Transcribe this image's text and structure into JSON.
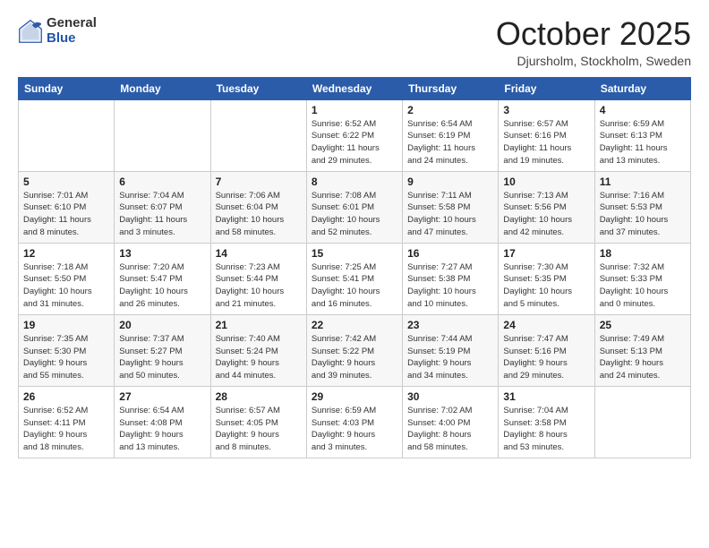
{
  "logo": {
    "general": "General",
    "blue": "Blue"
  },
  "title": {
    "month": "October 2025",
    "location": "Djursholm, Stockholm, Sweden"
  },
  "weekdays": [
    "Sunday",
    "Monday",
    "Tuesday",
    "Wednesday",
    "Thursday",
    "Friday",
    "Saturday"
  ],
  "weeks": [
    [
      {
        "day": "",
        "info": ""
      },
      {
        "day": "",
        "info": ""
      },
      {
        "day": "",
        "info": ""
      },
      {
        "day": "1",
        "info": "Sunrise: 6:52 AM\nSunset: 6:22 PM\nDaylight: 11 hours\nand 29 minutes."
      },
      {
        "day": "2",
        "info": "Sunrise: 6:54 AM\nSunset: 6:19 PM\nDaylight: 11 hours\nand 24 minutes."
      },
      {
        "day": "3",
        "info": "Sunrise: 6:57 AM\nSunset: 6:16 PM\nDaylight: 11 hours\nand 19 minutes."
      },
      {
        "day": "4",
        "info": "Sunrise: 6:59 AM\nSunset: 6:13 PM\nDaylight: 11 hours\nand 13 minutes."
      }
    ],
    [
      {
        "day": "5",
        "info": "Sunrise: 7:01 AM\nSunset: 6:10 PM\nDaylight: 11 hours\nand 8 minutes."
      },
      {
        "day": "6",
        "info": "Sunrise: 7:04 AM\nSunset: 6:07 PM\nDaylight: 11 hours\nand 3 minutes."
      },
      {
        "day": "7",
        "info": "Sunrise: 7:06 AM\nSunset: 6:04 PM\nDaylight: 10 hours\nand 58 minutes."
      },
      {
        "day": "8",
        "info": "Sunrise: 7:08 AM\nSunset: 6:01 PM\nDaylight: 10 hours\nand 52 minutes."
      },
      {
        "day": "9",
        "info": "Sunrise: 7:11 AM\nSunset: 5:58 PM\nDaylight: 10 hours\nand 47 minutes."
      },
      {
        "day": "10",
        "info": "Sunrise: 7:13 AM\nSunset: 5:56 PM\nDaylight: 10 hours\nand 42 minutes."
      },
      {
        "day": "11",
        "info": "Sunrise: 7:16 AM\nSunset: 5:53 PM\nDaylight: 10 hours\nand 37 minutes."
      }
    ],
    [
      {
        "day": "12",
        "info": "Sunrise: 7:18 AM\nSunset: 5:50 PM\nDaylight: 10 hours\nand 31 minutes."
      },
      {
        "day": "13",
        "info": "Sunrise: 7:20 AM\nSunset: 5:47 PM\nDaylight: 10 hours\nand 26 minutes."
      },
      {
        "day": "14",
        "info": "Sunrise: 7:23 AM\nSunset: 5:44 PM\nDaylight: 10 hours\nand 21 minutes."
      },
      {
        "day": "15",
        "info": "Sunrise: 7:25 AM\nSunset: 5:41 PM\nDaylight: 10 hours\nand 16 minutes."
      },
      {
        "day": "16",
        "info": "Sunrise: 7:27 AM\nSunset: 5:38 PM\nDaylight: 10 hours\nand 10 minutes."
      },
      {
        "day": "17",
        "info": "Sunrise: 7:30 AM\nSunset: 5:35 PM\nDaylight: 10 hours\nand 5 minutes."
      },
      {
        "day": "18",
        "info": "Sunrise: 7:32 AM\nSunset: 5:33 PM\nDaylight: 10 hours\nand 0 minutes."
      }
    ],
    [
      {
        "day": "19",
        "info": "Sunrise: 7:35 AM\nSunset: 5:30 PM\nDaylight: 9 hours\nand 55 minutes."
      },
      {
        "day": "20",
        "info": "Sunrise: 7:37 AM\nSunset: 5:27 PM\nDaylight: 9 hours\nand 50 minutes."
      },
      {
        "day": "21",
        "info": "Sunrise: 7:40 AM\nSunset: 5:24 PM\nDaylight: 9 hours\nand 44 minutes."
      },
      {
        "day": "22",
        "info": "Sunrise: 7:42 AM\nSunset: 5:22 PM\nDaylight: 9 hours\nand 39 minutes."
      },
      {
        "day": "23",
        "info": "Sunrise: 7:44 AM\nSunset: 5:19 PM\nDaylight: 9 hours\nand 34 minutes."
      },
      {
        "day": "24",
        "info": "Sunrise: 7:47 AM\nSunset: 5:16 PM\nDaylight: 9 hours\nand 29 minutes."
      },
      {
        "day": "25",
        "info": "Sunrise: 7:49 AM\nSunset: 5:13 PM\nDaylight: 9 hours\nand 24 minutes."
      }
    ],
    [
      {
        "day": "26",
        "info": "Sunrise: 6:52 AM\nSunset: 4:11 PM\nDaylight: 9 hours\nand 18 minutes."
      },
      {
        "day": "27",
        "info": "Sunrise: 6:54 AM\nSunset: 4:08 PM\nDaylight: 9 hours\nand 13 minutes."
      },
      {
        "day": "28",
        "info": "Sunrise: 6:57 AM\nSunset: 4:05 PM\nDaylight: 9 hours\nand 8 minutes."
      },
      {
        "day": "29",
        "info": "Sunrise: 6:59 AM\nSunset: 4:03 PM\nDaylight: 9 hours\nand 3 minutes."
      },
      {
        "day": "30",
        "info": "Sunrise: 7:02 AM\nSunset: 4:00 PM\nDaylight: 8 hours\nand 58 minutes."
      },
      {
        "day": "31",
        "info": "Sunrise: 7:04 AM\nSunset: 3:58 PM\nDaylight: 8 hours\nand 53 minutes."
      },
      {
        "day": "",
        "info": ""
      }
    ]
  ]
}
